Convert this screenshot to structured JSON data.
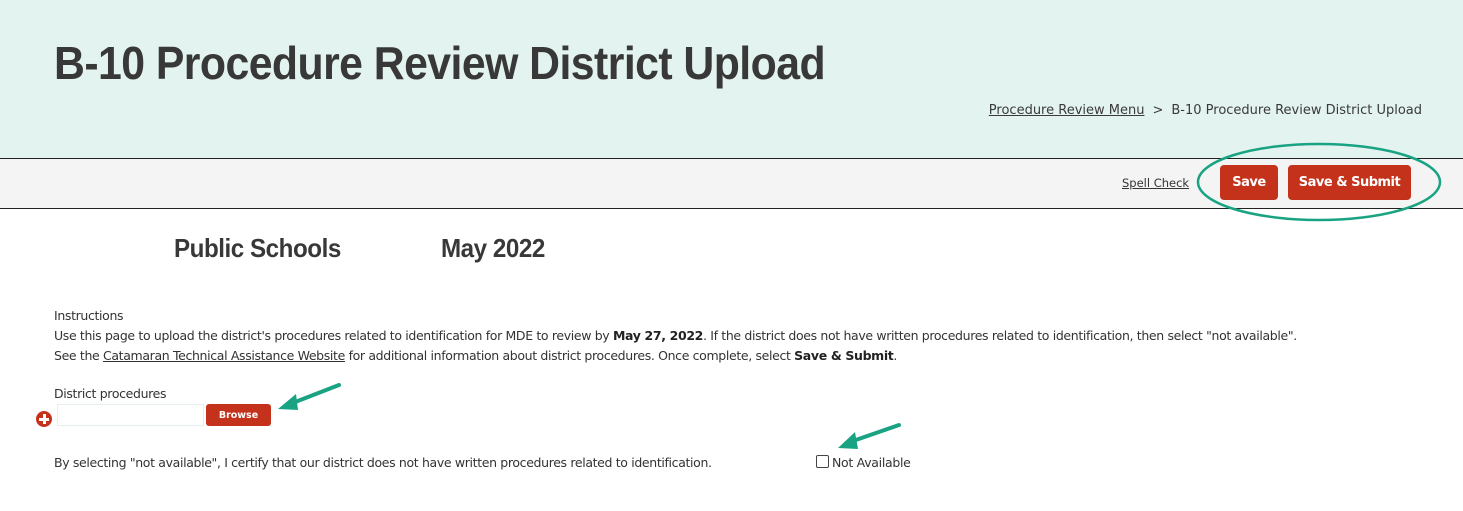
{
  "header": {
    "title": "B-10 Procedure Review District Upload",
    "breadcrumb": {
      "parent_link": "Procedure Review Menu",
      "separator": ">",
      "current": "B-10 Procedure Review District Upload"
    }
  },
  "toolbar": {
    "spell_check_label": "Spell Check",
    "save_label": "Save",
    "save_submit_label": "Save & Submit"
  },
  "context": {
    "school": "Public Schools",
    "period": "May 2022"
  },
  "instructions": {
    "heading": "Instructions",
    "line1_before": "Use this page to upload the district's procedures related to identification for MDE to review by ",
    "line1_date": "May 27, 2022",
    "line1_after": ". If the district does not have written procedures related to identification, then select \"not available\".",
    "line2_before": "See the ",
    "line2_link": "Catamaran Technical Assistance Website",
    "line2_middle": " for additional information about district procedures. Once complete, select ",
    "line2_bold": "Save & Submit",
    "line2_after": "."
  },
  "upload": {
    "label": "District procedures",
    "file_value": "",
    "browse_label": "Browse"
  },
  "not_available": {
    "certify_text": "By selecting \"not available\", I certify that our district does not have written procedures related to identification.",
    "checkbox_label": "Not Available",
    "checked": false
  },
  "colors": {
    "header_bg": "#e3f3ef",
    "toolbar_bg": "#f4f4f4",
    "button_red": "#c5321c",
    "annotation_green": "#1aa383",
    "title_text": "#383838"
  }
}
